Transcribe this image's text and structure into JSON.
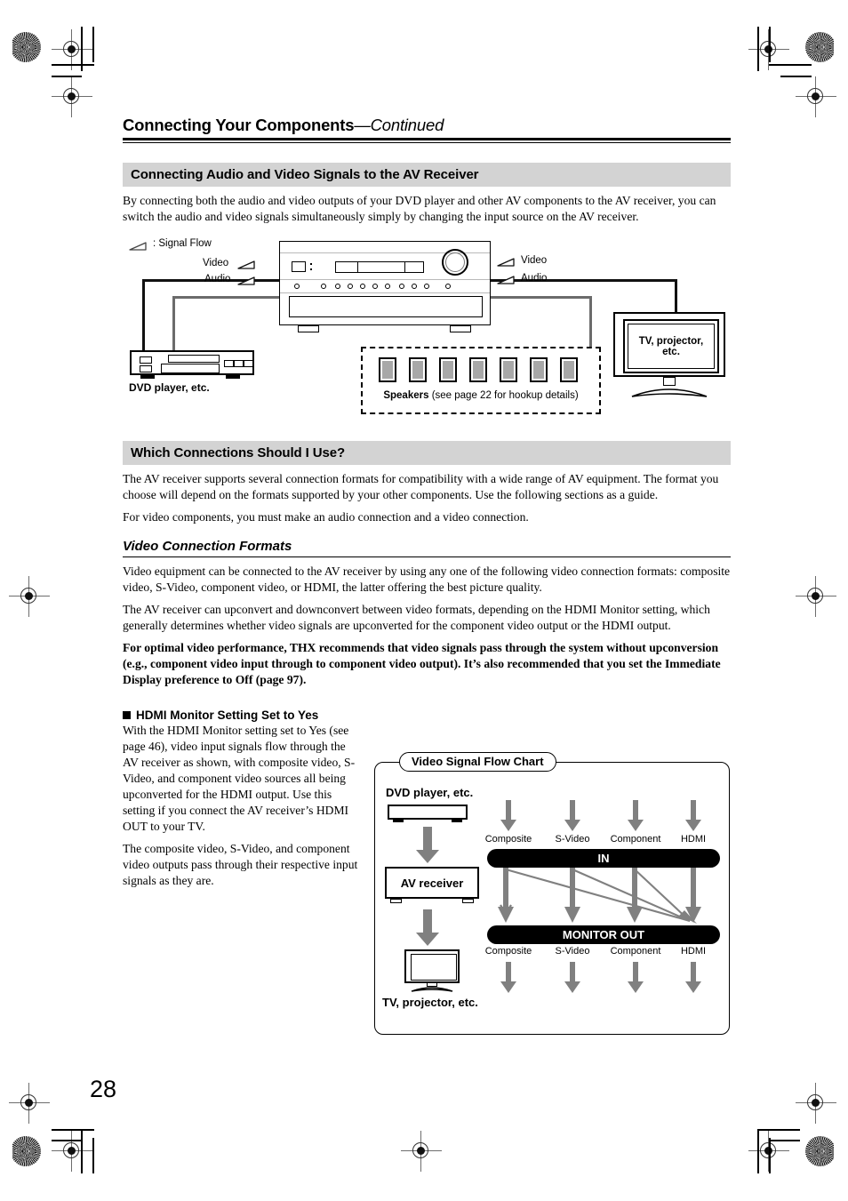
{
  "page": {
    "number": "28",
    "title_main": "Connecting Your Components",
    "title_cont": "—Continued"
  },
  "section1": {
    "heading": "Connecting Audio and Video Signals to the AV Receiver",
    "paragraph": "By connecting both the audio and video outputs of your DVD player and other AV components to the AV receiver, you can switch the audio and video signals simultaneously simply by changing the input source on the AV receiver."
  },
  "hookup_diagram": {
    "legend": ": Signal Flow",
    "video_left": "Video",
    "audio_left": "Audio",
    "video_right": "Video",
    "audio_right": "Audio",
    "dvd_label": "DVD player, etc.",
    "tv_label_line1": "TV, projector,",
    "tv_label_line2": "etc.",
    "speakers_label": "Speakers",
    "speakers_note": "(see page 22 for hookup details)",
    "speaker_count": 7
  },
  "section2": {
    "heading": "Which Connections Should I Use?",
    "paragraph1": "The AV receiver supports several connection formats for compatibility with a wide range of AV equipment. The format you choose will depend on the formats supported by your other components. Use the following sections as a guide.",
    "paragraph2": "For video components, you must make an audio connection and a video connection."
  },
  "section3": {
    "heading": "Video Connection Formats",
    "paragraph1": "Video equipment can be connected to the AV receiver by using any one of the following video connection formats: composite video, S-Video, component video, or HDMI, the latter offering the best picture quality.",
    "paragraph2": "The AV receiver can upconvert and downconvert between video formats, depending on the HDMI Monitor setting, which generally determines whether video signals are upconverted for the component video output or the HDMI output.",
    "paragraph3_bold": "For optimal video performance, THX recommends that video signals pass through the system without upconversion (e.g., component video input through to component video output). It’s also recommended that you set the Immediate Display preference to Off (page 97)."
  },
  "section4": {
    "heading": "HDMI Monitor Setting Set to Yes",
    "paragraph1": "With the HDMI Monitor setting set to Yes (see page 46), video input signals flow through the AV receiver as shown, with composite video, S-Video, and component video sources all being upconverted for the HDMI output. Use this setting if you connect the AV receiver’s HDMI OUT to your TV.",
    "paragraph2": "The composite video, S-Video, and component video outputs pass through their respective input signals as they are."
  },
  "chart_data": {
    "type": "diagram",
    "title": "Video Signal Flow Chart",
    "nodes": [
      {
        "id": "dvd",
        "label": "DVD player, etc."
      },
      {
        "id": "avr",
        "label": "AV receiver"
      },
      {
        "id": "tv",
        "label": "TV, projector, etc."
      }
    ],
    "bars": [
      {
        "id": "in",
        "label": "IN"
      },
      {
        "id": "out",
        "label": "MONITOR OUT"
      }
    ],
    "inputs": [
      "Composite",
      "S-Video",
      "Component",
      "HDMI"
    ],
    "outputs": [
      "Composite",
      "S-Video",
      "Component",
      "HDMI"
    ],
    "edges": [
      {
        "from": "Composite",
        "to": "Composite",
        "kind": "straight"
      },
      {
        "from": "S-Video",
        "to": "S-Video",
        "kind": "straight"
      },
      {
        "from": "Component",
        "to": "Component",
        "kind": "straight"
      },
      {
        "from": "HDMI",
        "to": "HDMI",
        "kind": "straight"
      },
      {
        "from": "Composite",
        "to": "HDMI",
        "kind": "upconvert"
      },
      {
        "from": "S-Video",
        "to": "HDMI",
        "kind": "upconvert"
      },
      {
        "from": "Component",
        "to": "HDMI",
        "kind": "upconvert"
      }
    ],
    "vertical_chain": [
      "dvd",
      "avr",
      "tv"
    ],
    "colors": {
      "bar": "#000000",
      "arrow": "#808080",
      "border": "#000000"
    }
  },
  "colors": {
    "band_gray": "#d3d3d3",
    "arrow_gray": "#808080",
    "speaker_gray": "#a8a8a8",
    "audio_wire": "#6b6b6b",
    "video_wire": "#111111"
  }
}
